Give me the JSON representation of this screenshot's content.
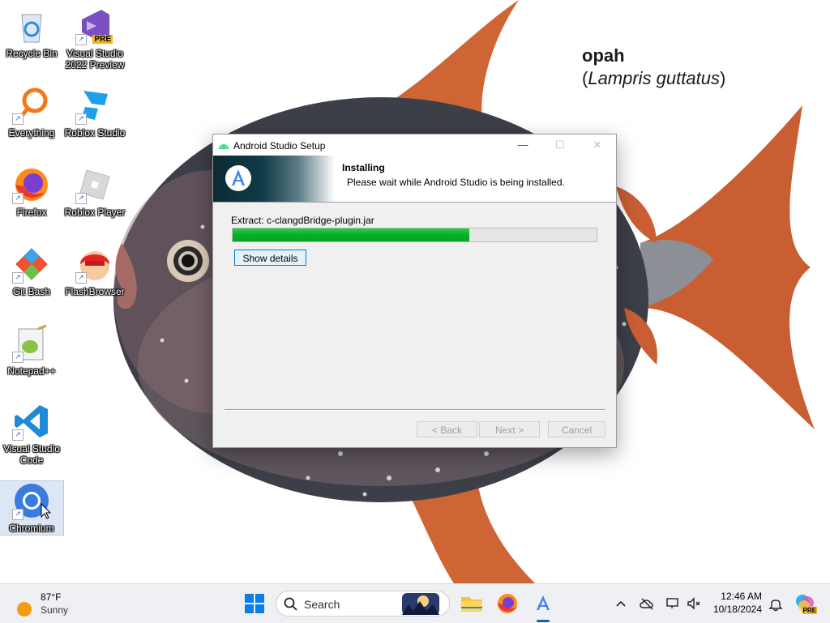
{
  "wallpaper": {
    "common_name": "opah",
    "scientific_name": "Lampris guttatus",
    "paren_open": "(",
    "paren_close": ")"
  },
  "desktop": {
    "icons": [
      {
        "label": "Recycle Bin"
      },
      {
        "label": "Visual Studio 2022 Preview",
        "badge": "PRE"
      },
      {
        "label": "Everything"
      },
      {
        "label": "Roblox Studio"
      },
      {
        "label": "Firefox"
      },
      {
        "label": "Roblox Player"
      },
      {
        "label": "Git Bash"
      },
      {
        "label": "FlashBrowser"
      },
      {
        "label": "Notepad++"
      },
      {
        "label": "Visual Studio Code"
      },
      {
        "label": "Chromium"
      }
    ]
  },
  "dialog": {
    "title": "Android Studio Setup",
    "header_title": "Installing",
    "header_subtitle": "Please wait while Android Studio is being installed.",
    "status_text": "Extract: c-clangdBridge-plugin.jar",
    "progress_fraction": 0.65,
    "show_details_label": "Show details",
    "back_label": "< Back",
    "next_label": "Next >",
    "cancel_label": "Cancel",
    "minimize_glyph": "—",
    "maximize_glyph": "☐",
    "close_glyph": "✕"
  },
  "taskbar": {
    "weather": {
      "temp": "87°F",
      "condition": "Sunny"
    },
    "search_label": "Search",
    "clock": {
      "time": "12:46 AM",
      "date": "10/18/2024"
    },
    "tray_badge": "PRE"
  },
  "colors": {
    "progress_green": "#06b025",
    "accent_blue": "#0078d7",
    "taskbar_bg": "#eef0f4"
  }
}
